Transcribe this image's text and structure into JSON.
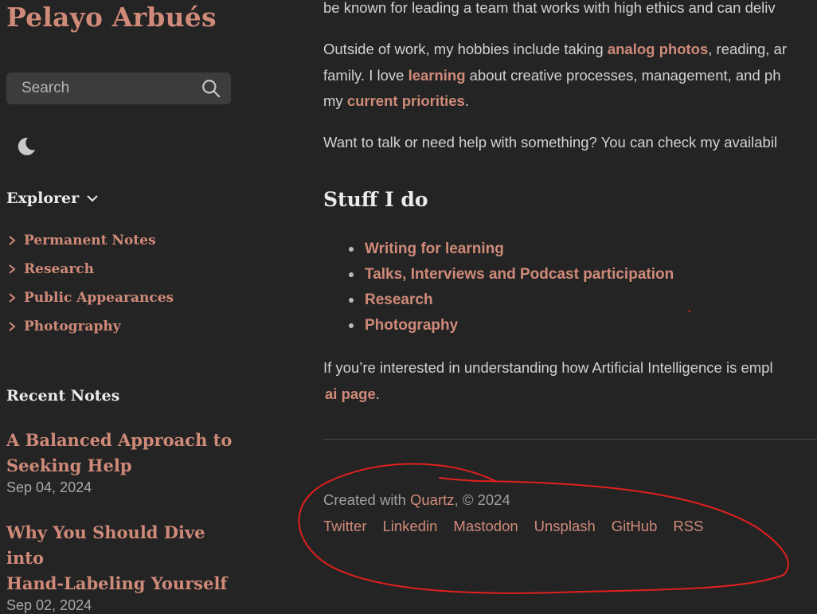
{
  "sidebar": {
    "site_title": "Pelayo Arbués",
    "search_placeholder": "Search",
    "explorer": {
      "title": "Explorer",
      "items": [
        {
          "label": "Permanent Notes"
        },
        {
          "label": "Research"
        },
        {
          "label": "Public Appearances"
        },
        {
          "label": "Photography"
        }
      ]
    },
    "recent": {
      "title": "Recent Notes",
      "notes": [
        {
          "title_line1": "A Balanced Approach to",
          "title_line2": "Seeking Help",
          "date": "Sep 04, 2024"
        },
        {
          "title_line1": "Why You Should Dive into",
          "title_line2": "Hand-Labeling Yourself",
          "date": "Sep 02, 2024"
        }
      ]
    }
  },
  "main": {
    "p_top": "be known for leading a team that works with high ethics and can deliv",
    "p_hobbies": {
      "l1_a": "Outside of work, my hobbies include taking ",
      "l1_link": "analog photos",
      "l1_b": ", reading, ar",
      "l2_a": "family. I love ",
      "l2_link": "learning",
      "l2_b": " about creative processes, management, and ph",
      "l3_a": "my ",
      "l3_link": "current priorities",
      "l3_b": "."
    },
    "p_talk": "Want to talk or need help with something? You can check my availabil",
    "stuff_heading": "Stuff I do",
    "stuff_items": [
      {
        "label": "Writing for learning"
      },
      {
        "label": "Talks, Interviews and Podcast participation"
      },
      {
        "label": "Research"
      },
      {
        "label": "Photography"
      }
    ],
    "p_ai": {
      "l1": "If you’re interested in understanding how Artificial Intelligence is empl",
      "l2_link": "ai page",
      "l2_b": "."
    }
  },
  "footer": {
    "credit_prefix": "Created with ",
    "credit_link": "Quartz",
    "credit_suffix": ", © 2024",
    "links": [
      {
        "label": "Twitter"
      },
      {
        "label": "Linkedin"
      },
      {
        "label": "Mastodon"
      },
      {
        "label": "Unsplash"
      },
      {
        "label": "GitHub"
      },
      {
        "label": "RSS"
      }
    ]
  },
  "colors": {
    "background": "#242424",
    "accent": "#d08a79",
    "annotation": "#e0201e"
  },
  "icons": [
    "search-icon",
    "moon-icon",
    "chevron-down-icon",
    "chevron-right-icon"
  ]
}
